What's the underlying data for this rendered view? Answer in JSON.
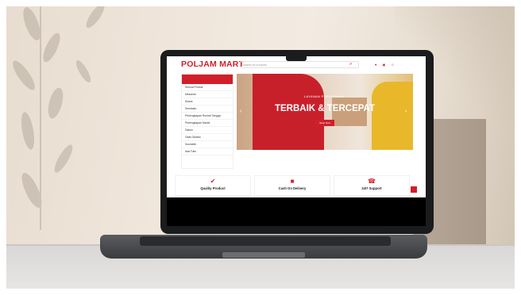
{
  "site": {
    "brand": "POLJAM MART",
    "search_placeholder": "search for products",
    "header_icons": [
      "heart-icon",
      "cart-icon",
      "user-icon"
    ],
    "categories": [
      "Semua Produk",
      "Minuman",
      "Snack",
      "Sembako",
      "Perlengkapan Rumah Tangga",
      "Perlengkapan Mandi",
      "Sabun",
      "Obat-Obatan",
      "Kosmetik",
      "Alat Tulis"
    ],
    "hero": {
      "tagline": "LAYANAN PENGIRIMAN",
      "title": "TERBAIK & TERCEPAT",
      "button": "Shop Now"
    },
    "features": [
      {
        "icon": "check-icon",
        "label": "Quality Product"
      },
      {
        "icon": "truck-icon",
        "label": "Cash On Delivery"
      },
      {
        "icon": "phone-icon",
        "label": "24/7 Support"
      }
    ],
    "accent_color": "#d11f2a"
  }
}
